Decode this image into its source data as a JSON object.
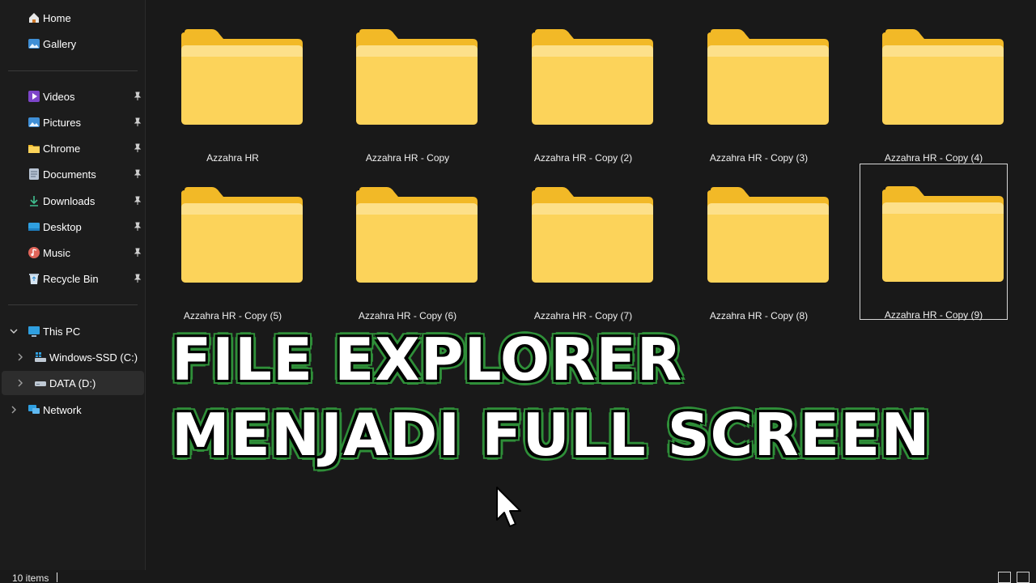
{
  "sidebar": {
    "quick": [
      {
        "label": "Home",
        "icon": "home-icon"
      },
      {
        "label": "Gallery",
        "icon": "gallery-icon"
      }
    ],
    "pinned": [
      {
        "label": "Videos",
        "icon": "videos-folder-icon"
      },
      {
        "label": "Pictures",
        "icon": "pictures-folder-icon"
      },
      {
        "label": "Chrome",
        "icon": "folder-icon"
      },
      {
        "label": "Documents",
        "icon": "documents-folder-icon"
      },
      {
        "label": "Downloads",
        "icon": "download-icon"
      },
      {
        "label": "Desktop",
        "icon": "desktop-folder-icon"
      },
      {
        "label": "Music",
        "icon": "music-folder-icon"
      },
      {
        "label": "Recycle Bin",
        "icon": "recycle-bin-icon"
      }
    ],
    "this_pc": {
      "label": "This PC",
      "icon": "computer-icon"
    },
    "drives": [
      {
        "label": "Windows-SSD (C:)",
        "icon": "windows-drive-icon"
      },
      {
        "label": "DATA (D:)",
        "icon": "drive-icon",
        "selected": true
      }
    ],
    "network": {
      "label": "Network",
      "icon": "network-icon"
    }
  },
  "folders": [
    {
      "name": "Azzahra HR"
    },
    {
      "name": "Azzahra HR - Copy"
    },
    {
      "name": "Azzahra HR - Copy (2)"
    },
    {
      "name": "Azzahra HR - Copy (3)"
    },
    {
      "name": "Azzahra HR - Copy (4)"
    },
    {
      "name": "Azzahra HR - Copy (5)"
    },
    {
      "name": "Azzahra HR - Copy (6)"
    },
    {
      "name": "Azzahra HR - Copy (7)"
    },
    {
      "name": "Azzahra HR - Copy (8)"
    },
    {
      "name": "Azzahra HR - Copy (9)",
      "focused": true
    }
  ],
  "overlay": {
    "line1": "FILE EXPLORER",
    "line2": "MENJADI FULL SCREEN"
  },
  "status": {
    "item_count": "10 items"
  },
  "colors": {
    "background": "#191919",
    "sidebar": "#1c1c1c",
    "folder_back": "#f2b927",
    "folder_front": "#fcd35a",
    "caption_outline": "#2f8f39"
  }
}
